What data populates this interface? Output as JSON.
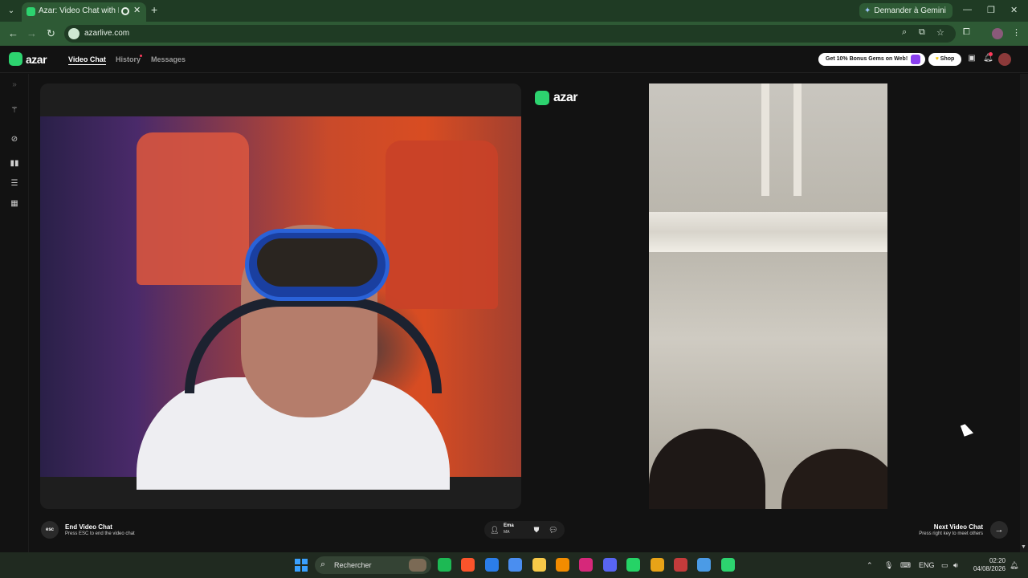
{
  "browser": {
    "tab_title": "Azar: Video Chat with New",
    "new_tab": "+",
    "gemini_label": "Demander à Gemini",
    "url": "azarlive.com"
  },
  "app": {
    "logo_text": "azar",
    "nav": [
      "Video Chat",
      "History",
      "Messages"
    ],
    "bonus_label": "Get 10% Bonus Gems on Web!",
    "shop_label": "Shop"
  },
  "stage": {
    "logo_text": "azar"
  },
  "controls": {
    "esc_key": "esc",
    "end_title": "End Video Chat",
    "end_sub": "Press ESC to end the video chat",
    "peer_name": "Ema",
    "peer_country": "MA",
    "next_title": "Next Video Chat",
    "next_sub": "Press right key to meet others"
  },
  "taskbar": {
    "search_placeholder": "Rechercher",
    "lang": "ENG",
    "time": "02:20",
    "date": "04/08/2026",
    "apps": [
      {
        "name": "spotify-icon",
        "color": "#1db954"
      },
      {
        "name": "brave-icon",
        "color": "#fb542b"
      },
      {
        "name": "defender-icon",
        "color": "#2b7de9"
      },
      {
        "name": "store-icon",
        "color": "#4a8ef0"
      },
      {
        "name": "file-explorer-icon",
        "color": "#f7c948"
      },
      {
        "name": "vlc-icon",
        "color": "#f28c00"
      },
      {
        "name": "instagram-icon",
        "color": "#d6287a"
      },
      {
        "name": "discord-icon",
        "color": "#5865f2"
      },
      {
        "name": "whatsapp-icon",
        "color": "#25d366"
      },
      {
        "name": "chrome-icon",
        "color": "#e8a317"
      },
      {
        "name": "chrome-profile-icon",
        "color": "#c43b3b"
      },
      {
        "name": "chrome-profile-2-icon",
        "color": "#4b9be6"
      },
      {
        "name": "chrome-active-icon",
        "color": "#2dd36f"
      }
    ]
  }
}
